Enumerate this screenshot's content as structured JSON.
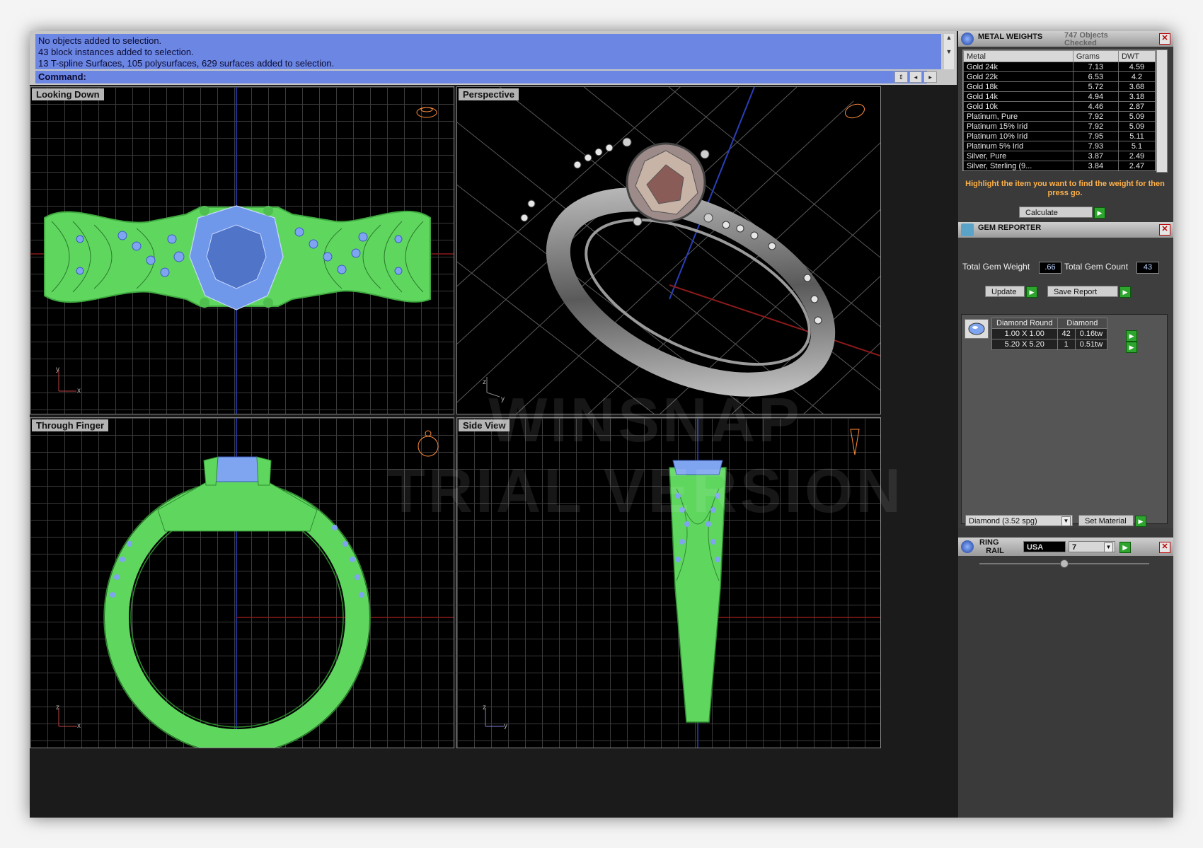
{
  "command": {
    "history": [
      "No objects added to selection.",
      "43 block instances added to selection.",
      "13 T-spline Surfaces, 105 polysurfaces, 629 surfaces added to selection."
    ],
    "prompt": "Command:"
  },
  "viewports": {
    "top": "Looking Down",
    "perspective": "Perspective",
    "front": "Through Finger",
    "side": "Side View"
  },
  "axes": {
    "top": [
      "y",
      "x"
    ],
    "persp": [
      "z",
      "y"
    ],
    "front": [
      "z",
      "x"
    ],
    "side": [
      "z",
      "y"
    ]
  },
  "watermark": [
    "WINSNAP",
    "TRIAL VERSION"
  ],
  "metal_weights": {
    "title": "METAL WEIGHTS",
    "objects_checked": "747 Objects Checked",
    "columns": [
      "Metal",
      "Grams",
      "DWT"
    ],
    "rows": [
      [
        "Gold 24k",
        "7.13",
        "4.59"
      ],
      [
        "Gold 22k",
        "6.53",
        "4.2"
      ],
      [
        "Gold 18k",
        "5.72",
        "3.68"
      ],
      [
        "Gold 14k",
        "4.94",
        "3.18"
      ],
      [
        "Gold 10k",
        "4.46",
        "2.87"
      ],
      [
        "Platinum, Pure",
        "7.92",
        "5.09"
      ],
      [
        "Platinum 15% Irid",
        "7.92",
        "5.09"
      ],
      [
        "Platinum 10% Irid",
        "7.95",
        "5.11"
      ],
      [
        "Platinum 5% Irid",
        "7.93",
        "5.1"
      ],
      [
        "Silver, Pure",
        "3.87",
        "2.49"
      ],
      [
        "Silver, Sterling (9...",
        "3.84",
        "2.47"
      ]
    ],
    "hint": "Highlight the item you want to find the weight for then press go.",
    "calculate": "Calculate"
  },
  "gem_reporter": {
    "title": "GEM REPORTER",
    "total_weight_label": "Total Gem Weight",
    "total_weight": ".66",
    "total_count_label": "Total Gem Count",
    "total_count": "43",
    "update": "Update",
    "save_report": "Save Report",
    "headers": [
      "Diamond Round",
      "Diamond"
    ],
    "gems": [
      {
        "size": "1.00 X 1.00",
        "count": "42",
        "weight": "0.16tw"
      },
      {
        "size": "5.20 X 5.20",
        "count": "1",
        "weight": "0.51tw"
      }
    ],
    "material": "Diamond    (3.52 spg)",
    "set_material": "Set Material"
  },
  "ring_rail": {
    "title_line1": "RING",
    "title_line2": "RAIL",
    "region": "USA",
    "size": "7"
  }
}
